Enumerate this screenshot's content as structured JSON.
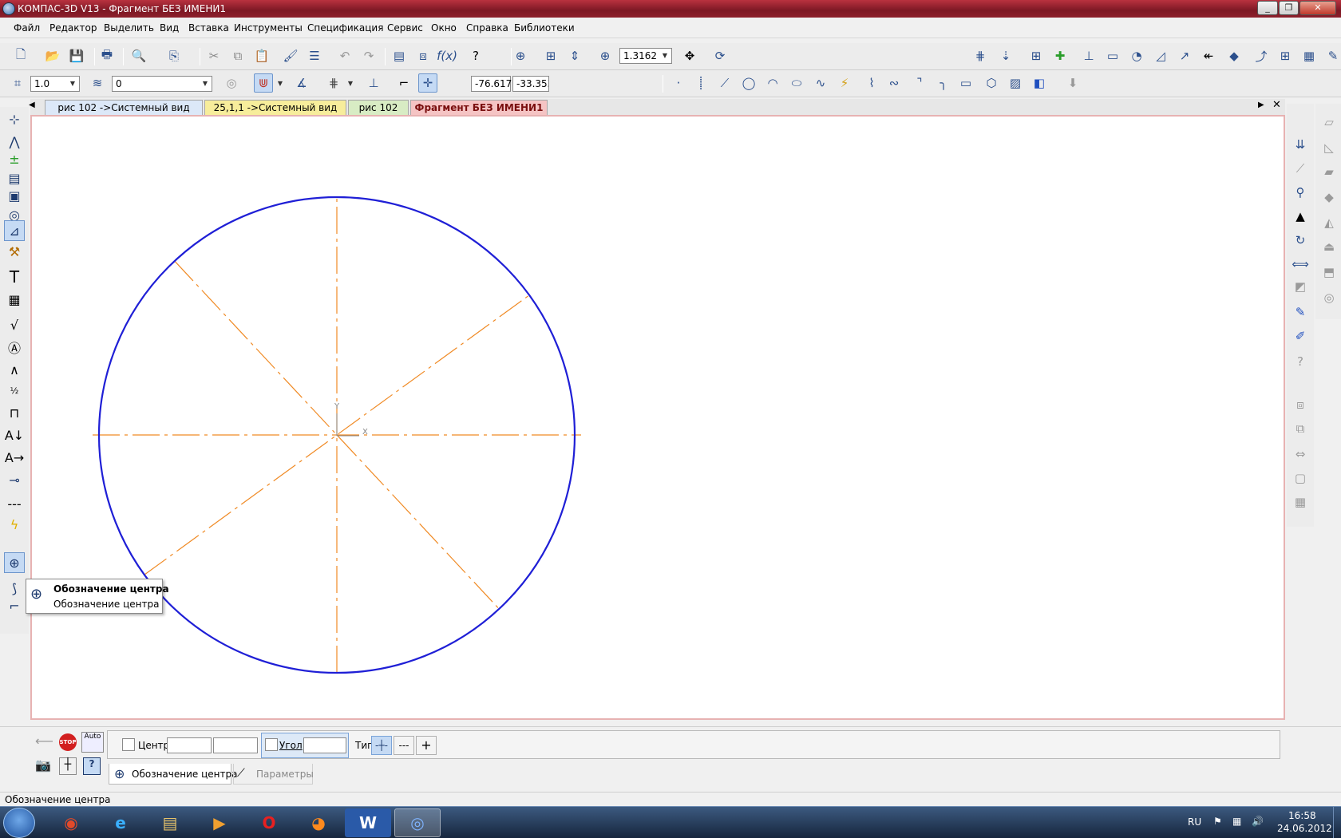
{
  "window": {
    "title": "КОМПАС-3D V13 - Фрагмент БЕЗ ИМЕНИ1",
    "minimize_symbol": "_",
    "restore_symbol": "❐",
    "close_symbol": "✕"
  },
  "menu": [
    "Файл",
    "Редактор",
    "Выделить",
    "Вид",
    "Вставка",
    "Инструменты",
    "Спецификация",
    "Сервис",
    "Окно",
    "Справка",
    "Библиотеки"
  ],
  "toolbar": {
    "zoom_value": "1.3162",
    "step_value": "1.0",
    "layer_value": "0",
    "coord_x": "-76.617",
    "coord_y": "-33.353",
    "coord_label_y": "Y",
    "coord_label_x": "X"
  },
  "tabs": [
    {
      "label": "рис 102 ->Системный вид",
      "color": "#dce8f8"
    },
    {
      "label": "25,1,1 ->Системный вид",
      "color": "#f7ed9b"
    },
    {
      "label": "рис 102",
      "color": "#d8ecc4"
    },
    {
      "label": "Фрагмент БЕЗ ИМЕНИ1",
      "color": "#f5c4c4",
      "active": true
    }
  ],
  "drawing": {
    "circle_color": "#1f1fd6",
    "centerline_color": "#f08a24",
    "axis_color": "#888888",
    "axis_x_label": "X",
    "axis_y_label": "Y"
  },
  "tooltip": {
    "title": "Обозначение центра",
    "subtitle": "Обозначение центра"
  },
  "properties": {
    "center_label": "Центр",
    "angle_label": "Угол",
    "type_label": "Тип",
    "auto_label": "Auto",
    "stop_label": "STOP",
    "tab_active": "Обозначение центра",
    "tab_params": "Параметры"
  },
  "status": {
    "text": "Обозначение центра"
  },
  "taskbar": {
    "lang": "RU",
    "time": "16:58",
    "date": "24.06.2012"
  }
}
